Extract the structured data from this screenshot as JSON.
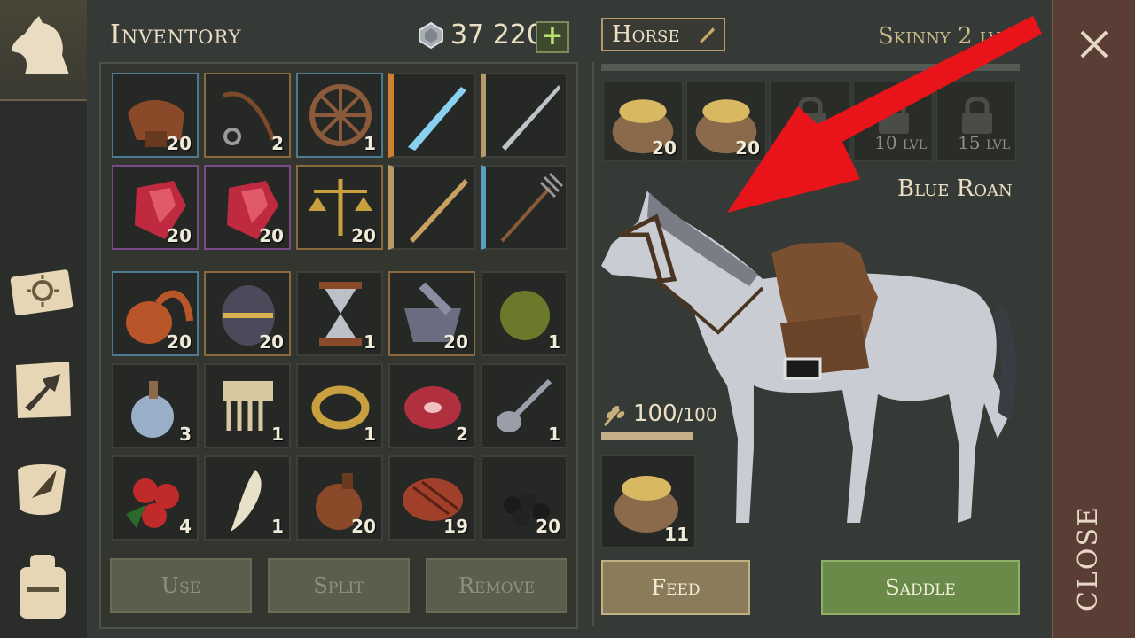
{
  "inventory": {
    "title": "Inventory",
    "currency": "37 220",
    "add_label": "+",
    "slots": [
      {
        "name": "saddle",
        "count": "20"
      },
      {
        "name": "bridle",
        "count": "2"
      },
      {
        "name": "wheel",
        "count": "1"
      },
      {
        "name": "ice-sword",
        "count": ""
      },
      {
        "name": "longsword",
        "count": ""
      },
      {
        "name": "ruby",
        "count": "20"
      },
      {
        "name": "ruby",
        "count": "20"
      },
      {
        "name": "scales",
        "count": "20"
      },
      {
        "name": "wooden-sword",
        "count": ""
      },
      {
        "name": "pitchfork",
        "count": ""
      },
      {
        "name": "gourd",
        "count": "20"
      },
      {
        "name": "egg",
        "count": "20"
      },
      {
        "name": "hourglass",
        "count": "1"
      },
      {
        "name": "mortar",
        "count": "20"
      },
      {
        "name": "herb-ball",
        "count": "1"
      },
      {
        "name": "potion",
        "count": "3"
      },
      {
        "name": "comb",
        "count": "1"
      },
      {
        "name": "ring",
        "count": "1"
      },
      {
        "name": "raw-meat",
        "count": "2"
      },
      {
        "name": "spoon",
        "count": "1"
      },
      {
        "name": "berries",
        "count": "4"
      },
      {
        "name": "fang",
        "count": "1"
      },
      {
        "name": "flask",
        "count": "20"
      },
      {
        "name": "grilled-meat",
        "count": "19"
      },
      {
        "name": "coal",
        "count": "20"
      }
    ],
    "buttons": {
      "use": "Use",
      "split": "Split",
      "remove": "Remove"
    }
  },
  "horse": {
    "tab_label": "Horse",
    "condition": "Skinny 2 lvl",
    "slots": [
      {
        "name": "feed-sack",
        "count": "20",
        "locked": false
      },
      {
        "name": "feed-sack",
        "count": "20",
        "locked": false
      },
      {
        "name": "locked",
        "count": "",
        "locked": true
      },
      {
        "name": "locked",
        "count": "10 lvl",
        "locked": true
      },
      {
        "name": "locked",
        "count": "15 lvl",
        "locked": true
      }
    ],
    "breed": "Blue Roan",
    "food_value": "100",
    "food_max": "/100",
    "food_fraction": 1.0,
    "feed_slot_count": "11",
    "buttons": {
      "feed": "Feed",
      "saddle": "Saddle"
    }
  },
  "close_label": "CLOSE",
  "colors": {
    "accent_green": "#6a8a4a",
    "close_panel": "#5a3e36",
    "annotation_arrow": "#e8141a"
  }
}
